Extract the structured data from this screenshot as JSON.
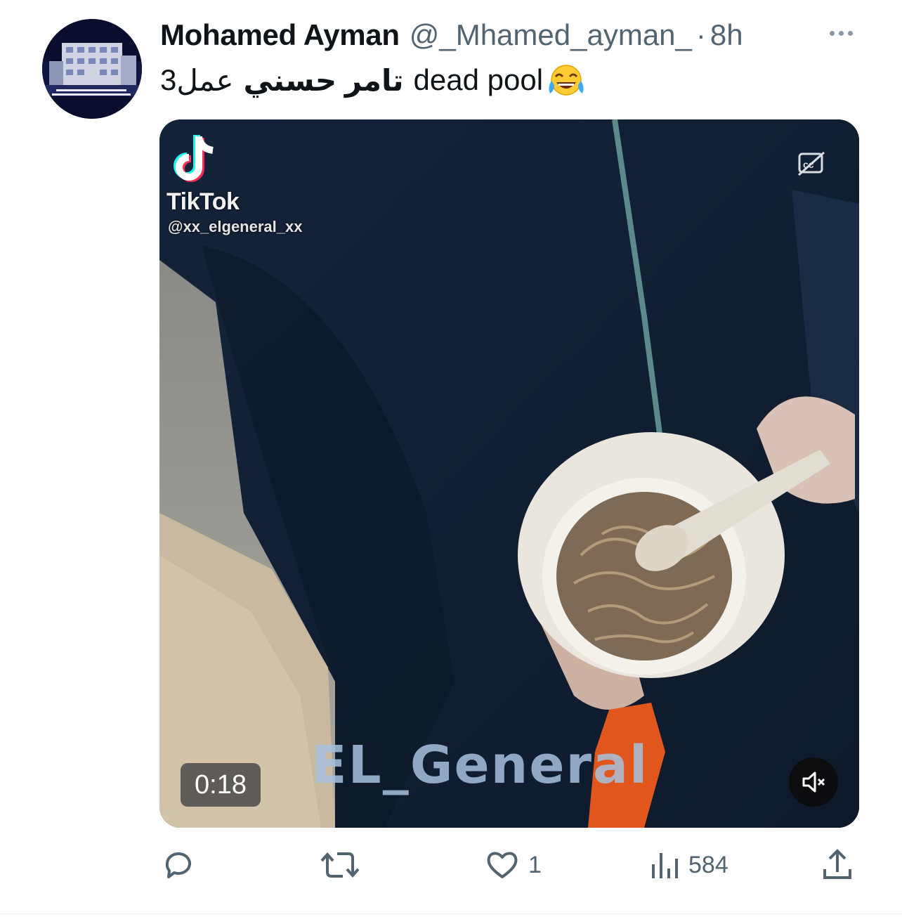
{
  "tweet": {
    "author": {
      "display_name": "Mohamed Ayman",
      "handle": "@_Mhamed_ayman_",
      "separator": "·",
      "time": "8h"
    },
    "text": {
      "part_digit": "3",
      "part_arabic_regular": "عمل",
      "part_arabic_bold": "تامر حسني",
      "part_english": "dead pool"
    },
    "emoji": "face-with-tears-of-joy",
    "media": {
      "tiktok_brand": "TikTok",
      "tiktok_user": "@xx_elgeneral_xx",
      "watermark": "EL_General",
      "duration": "0:18",
      "muted": true
    },
    "actions": {
      "replies": "",
      "retweets": "",
      "likes": "1",
      "views": "584"
    },
    "icons": [
      "more-icon",
      "cc-icon",
      "mute-icon",
      "reply-icon",
      "retweet-icon",
      "like-icon",
      "views-icon",
      "share-icon"
    ],
    "colors": {
      "text": "#0f1419",
      "secondary": "#536471"
    }
  }
}
